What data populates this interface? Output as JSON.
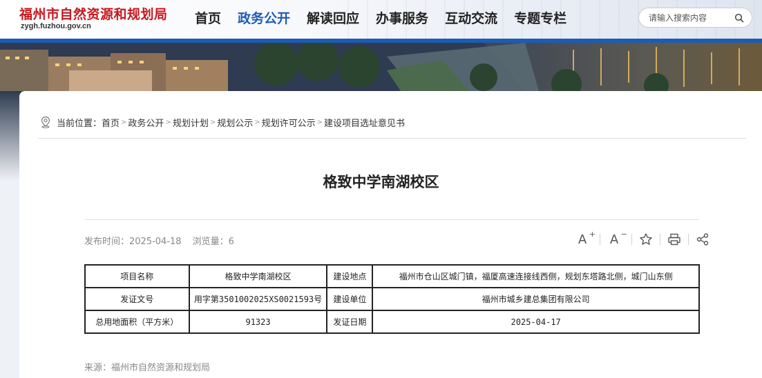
{
  "header": {
    "logo_title": "福州市自然资源和规划局",
    "logo_url": "zygh.fuzhou.gov.cn",
    "nav": [
      {
        "label": "首页",
        "active": false
      },
      {
        "label": "政务公开",
        "active": true
      },
      {
        "label": "解读回应",
        "active": false
      },
      {
        "label": "办事服务",
        "active": false
      },
      {
        "label": "互动交流",
        "active": false
      },
      {
        "label": "专题专栏",
        "active": false
      }
    ],
    "search_placeholder": "请输入搜索内容",
    "search_icon": "search-icon",
    "accent_color": "#1c5cb3"
  },
  "breadcrumb": {
    "prefix": "当前位置：",
    "icon": "location-pin-icon",
    "items": [
      "首页",
      "政务公开",
      "规划计划",
      "规划公示",
      "规划许可公示",
      "建设项目选址意见书"
    ]
  },
  "article": {
    "title": "格致中学南湖校区",
    "publish_label": "发布时间：",
    "publish_date": "2025-04-18",
    "views_label": "浏览量：",
    "views": "6",
    "tools": {
      "font_increase": "A",
      "font_decrease": "A",
      "favorite_icon": "star-icon",
      "print_icon": "print-icon",
      "share_icon": "share-icon"
    },
    "table": {
      "rows": [
        [
          "项目名称",
          "格致中学南湖校区",
          "建设地点",
          "福州市仓山区城门镇，福厦高速连接线西侧，规划东塔路北侧，城门山东侧"
        ],
        [
          "发证文号",
          "用字第3501002025XS0021593号",
          "建设单位",
          "福州市城乡建总集团有限公司"
        ],
        [
          "总用地面积（平方米）",
          "91323",
          "发证日期",
          "2025-04-17"
        ]
      ]
    },
    "source_label": "来源：",
    "source": "福州市自然资源和规划局"
  }
}
